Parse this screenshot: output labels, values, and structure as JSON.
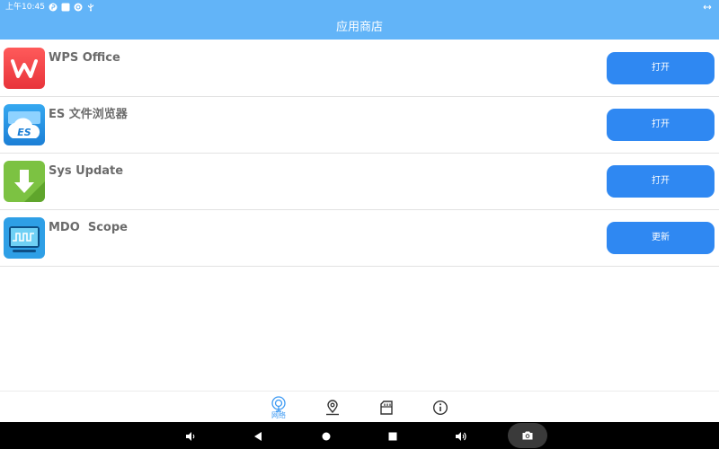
{
  "status_bar": {
    "time": "上午10:45",
    "icons": [
      "p-icon",
      "square-icon",
      "circle-icon",
      "usb-icon"
    ],
    "right_icon": "expand-arrows-icon"
  },
  "app_bar": {
    "title": "应用商店"
  },
  "apps": [
    {
      "name": "WPS Office",
      "icon": "wps-icon",
      "action": "打开"
    },
    {
      "name": "ES 文件浏览器",
      "icon": "es-file-explorer-icon",
      "action": "打开"
    },
    {
      "name": "Sys Update",
      "icon": "sys-update-icon",
      "action": "打开"
    },
    {
      "name": "MDO  Scope",
      "icon": "mdo-scope-icon",
      "action": "更新"
    }
  ],
  "bottom_nav": {
    "items": [
      {
        "icon": "network-icon",
        "label": "网络",
        "active": true
      },
      {
        "icon": "location-icon",
        "label": ""
      },
      {
        "icon": "storage-icon",
        "label": ""
      },
      {
        "icon": "info-icon",
        "label": ""
      }
    ]
  },
  "system_bar": {
    "buttons": [
      "volume-down-icon",
      "back-icon",
      "home-icon",
      "recents-icon",
      "volume-up-icon",
      "screenshot-icon"
    ]
  },
  "colors": {
    "header_bg": "#62b4f8",
    "button_bg": "#2f88f2",
    "nav_active": "#3d9af3",
    "app_name": "#6b6b6b"
  }
}
